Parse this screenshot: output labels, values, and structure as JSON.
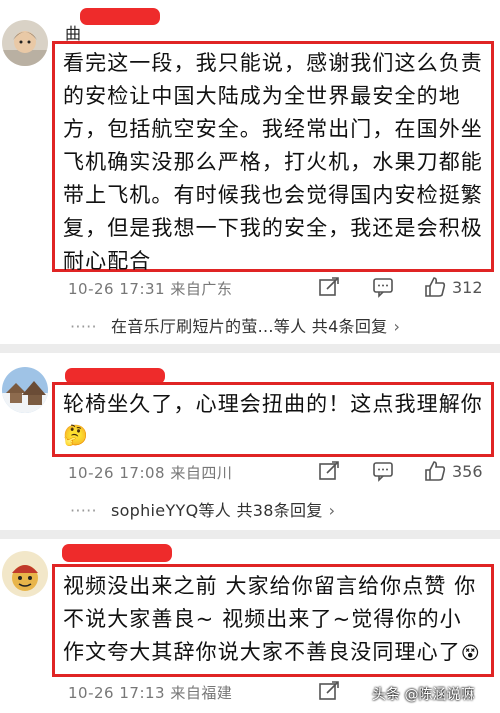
{
  "comments": [
    {
      "name_visible": "曲",
      "text_lines": [
        "看完这一段，我只能说，感谢我们这么负责",
        "的安检让中国大陆成为全世界最安全的地",
        "方，包括航空安全。我经常出门，在国外坐",
        "飞机确实没那么严格，打火机，水果刀都能",
        "带上飞机。有时候我也会觉得国内安检挺繁",
        "复，但是我想一下我的安全，我还是会积极",
        "耐心配合"
      ],
      "meta": "10-26 17:31 来自广东",
      "likes": "312",
      "replies_text": "在音乐厅刷短片的萤...等人 共4条回复",
      "dots": "·····",
      "chevron": "›"
    },
    {
      "text_lines": [
        "轮椅坐久了，心理会扭曲的！这点我理解你"
      ],
      "emoji": "🤔",
      "meta": "10-26 17:08 来自四川",
      "likes": "356",
      "replies_text": "sophieYYQ等人 共38条回复",
      "dots": "·····",
      "chevron": "›"
    },
    {
      "text_lines": [
        "视频没出来之前 大家给你留言给你点赞 你",
        "不说大家善良~ 视频出来了~觉得你的小",
        "作文夸大其辞你说大家不善良没同理心了"
      ],
      "emoji": "😵",
      "meta": "10-26 17:13 来自福建"
    }
  ],
  "icons": [
    "share-icon",
    "comment-icon",
    "like-icon"
  ],
  "watermark": "头条 @陈涵说嘛",
  "colors": {
    "highlight_border": "#e02424",
    "name_redaction": "#ee2b2b"
  }
}
